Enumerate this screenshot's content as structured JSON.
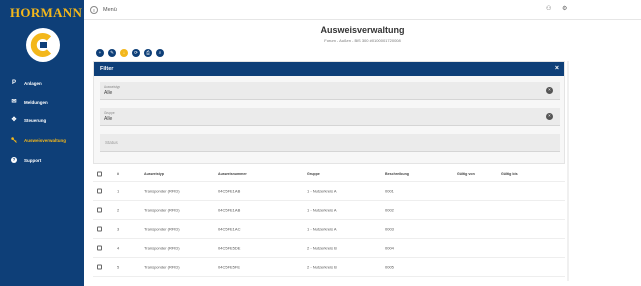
{
  "sidebar": {
    "logo": "HORMANN",
    "items": [
      {
        "icon": "location-pin-icon",
        "glyph": "P",
        "label": "Anlagen"
      },
      {
        "icon": "messages-icon",
        "glyph": "✉",
        "label": "Meldungen"
      },
      {
        "icon": "control-icon",
        "glyph": "✥",
        "label": "Steuerung"
      },
      {
        "icon": "key-icon",
        "glyph": "🔑",
        "label": "Ausweisverwaltung"
      },
      {
        "icon": "help-icon",
        "glyph": "?",
        "label": "Support"
      }
    ]
  },
  "topbar": {
    "menu_label": "Menü",
    "menu_glyph": "≡",
    "user_glyph": "⚇",
    "settings_glyph": "⚙"
  },
  "header": {
    "title": "Ausweisverwaltung",
    "subtitle": "Forum - Außen - BiS 300 #0100001720008"
  },
  "actions": [
    "+",
    "✎",
    "↓",
    "⟳",
    "⎙",
    "⌕"
  ],
  "filter": {
    "title": "Filter",
    "close": "×",
    "fields": [
      {
        "label": "Ausweistyp",
        "value": "Alle"
      },
      {
        "label": "Gruppe",
        "value": "Alle"
      }
    ],
    "status_placeholder": "Status"
  },
  "table": {
    "columns": [
      "#",
      "Ausweistyp",
      "Ausweisnummer",
      "Gruppe",
      "Beschreibung",
      "Gültig von",
      "Gültig bis"
    ],
    "rows": [
      [
        "1",
        "Transponder (RFID)",
        "04C5FE1AB",
        "1 - Nutzerkreis A",
        "0001",
        "",
        ""
      ],
      [
        "2",
        "Transponder (RFID)",
        "04C5FE1AB",
        "1 - Nutzerkreis A",
        "0002",
        "",
        ""
      ],
      [
        "3",
        "Transponder (RFID)",
        "04C5FE1AC",
        "1 - Nutzerkreis A",
        "0003",
        "",
        ""
      ],
      [
        "4",
        "Transponder (RFID)",
        "04C5FE5DE",
        "2 - Nutzerkreis B",
        "0004",
        "",
        ""
      ],
      [
        "5",
        "Transponder (RFID)",
        "04C5FE5FE",
        "2 - Nutzerkreis B",
        "0005",
        "",
        ""
      ]
    ]
  },
  "colors": {
    "primary": "#0e3f78",
    "accent": "#f3b71b"
  }
}
